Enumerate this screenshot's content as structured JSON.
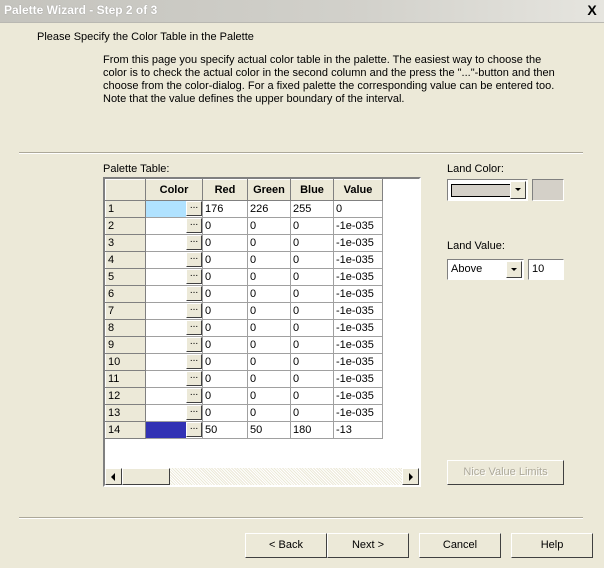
{
  "window": {
    "title": "Palette Wizard - Step 2 of 3",
    "close_symbol": "X"
  },
  "heading": "Please Specify the Color Table in the Palette",
  "description": "From this page you specify actual color table in the palette. The easiest way to choose the color is to check the actual color in the second column and the press the \"...\"-button and then choose from the color-dialog. For a fixed palette the corresponding value can be entered too. Note that the value defines the upper boundary of the interval.",
  "palette_table": {
    "label": "Palette Table:",
    "columns": [
      "Color",
      "Red",
      "Green",
      "Blue",
      "Value"
    ],
    "button_label": "...",
    "rows": [
      {
        "n": "1",
        "color": "#b0e2ff",
        "red": "176",
        "green": "226",
        "blue": "255",
        "value": "0"
      },
      {
        "n": "2",
        "color": "",
        "red": "0",
        "green": "0",
        "blue": "0",
        "value": "-1e-035"
      },
      {
        "n": "3",
        "color": "",
        "red": "0",
        "green": "0",
        "blue": "0",
        "value": "-1e-035"
      },
      {
        "n": "4",
        "color": "",
        "red": "0",
        "green": "0",
        "blue": "0",
        "value": "-1e-035"
      },
      {
        "n": "5",
        "color": "",
        "red": "0",
        "green": "0",
        "blue": "0",
        "value": "-1e-035"
      },
      {
        "n": "6",
        "color": "",
        "red": "0",
        "green": "0",
        "blue": "0",
        "value": "-1e-035"
      },
      {
        "n": "7",
        "color": "",
        "red": "0",
        "green": "0",
        "blue": "0",
        "value": "-1e-035"
      },
      {
        "n": "8",
        "color": "",
        "red": "0",
        "green": "0",
        "blue": "0",
        "value": "-1e-035"
      },
      {
        "n": "9",
        "color": "",
        "red": "0",
        "green": "0",
        "blue": "0",
        "value": "-1e-035"
      },
      {
        "n": "10",
        "color": "",
        "red": "0",
        "green": "0",
        "blue": "0",
        "value": "-1e-035"
      },
      {
        "n": "11",
        "color": "",
        "red": "0",
        "green": "0",
        "blue": "0",
        "value": "-1e-035"
      },
      {
        "n": "12",
        "color": "",
        "red": "0",
        "green": "0",
        "blue": "0",
        "value": "-1e-035"
      },
      {
        "n": "13",
        "color": "",
        "red": "0",
        "green": "0",
        "blue": "0",
        "value": "-1e-035"
      },
      {
        "n": "14",
        "color": "#3232b4",
        "red": "50",
        "green": "50",
        "blue": "180",
        "value": "-13"
      }
    ]
  },
  "land_color": {
    "label": "Land Color:",
    "color": "#d4d0c8"
  },
  "land_value": {
    "label": "Land Value:",
    "select_value": "Above",
    "value": "10"
  },
  "buttons": {
    "nice_value_limits": "Nice Value Limits",
    "back": "< Back",
    "next": "Next >",
    "cancel": "Cancel",
    "help": "Help"
  }
}
